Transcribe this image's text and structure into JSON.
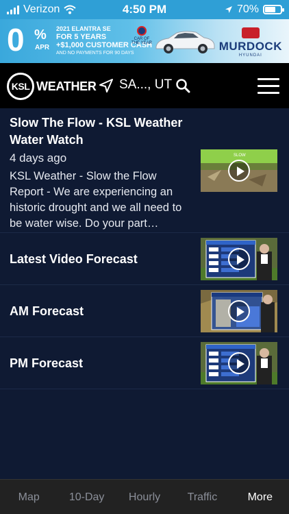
{
  "status_bar": {
    "carrier": "Verizon",
    "time": "4:50 PM",
    "battery": "70%",
    "battery_level": 0.7
  },
  "ad": {
    "zero": "0",
    "percent": "%",
    "apr": "APR",
    "line1": "2021 ELANTRA SE",
    "line2": "FOR 5 YEARS",
    "line3": "+$1,000 CUSTOMER CASH",
    "line4": "AND NO PAYMENTS FOR 90 DAYS",
    "award": "CAR OF THE YEAR",
    "brand": "MURDOCK",
    "brand_sub": "HYUNDAI"
  },
  "nav": {
    "logo_mark": "KSL",
    "logo_text": "WEATHER",
    "location": "SA..., UT"
  },
  "articles": [
    {
      "title": "Slow The Flow - KSL Weather Water Watch",
      "date": "4 days ago",
      "description": "KSL Weather - Slow the Flow Report - We are experiencing an historic drought and we all need to be water wise.  Do your part…",
      "thumb_icon": "sprinkler-thumbnail"
    },
    {
      "title": "Latest Video Forecast",
      "thumb_icon": "forecast-thumbnail"
    },
    {
      "title": "AM Forecast",
      "thumb_icon": "lawn-watering-thumbnail"
    },
    {
      "title": "PM Forecast",
      "thumb_icon": "forecast-thumbnail"
    }
  ],
  "tabs": [
    {
      "label": "Map",
      "active": false
    },
    {
      "label": "10-Day",
      "active": false
    },
    {
      "label": "Hourly",
      "active": false
    },
    {
      "label": "Traffic",
      "active": false
    },
    {
      "label": "More",
      "active": true
    }
  ],
  "colors": {
    "background": "#0f1a33",
    "status_bar": "#2f9fd6",
    "nav": "#000000",
    "tab_bar": "#222222",
    "tab_inactive": "#8b8f99",
    "tab_active": "#ffffff"
  }
}
